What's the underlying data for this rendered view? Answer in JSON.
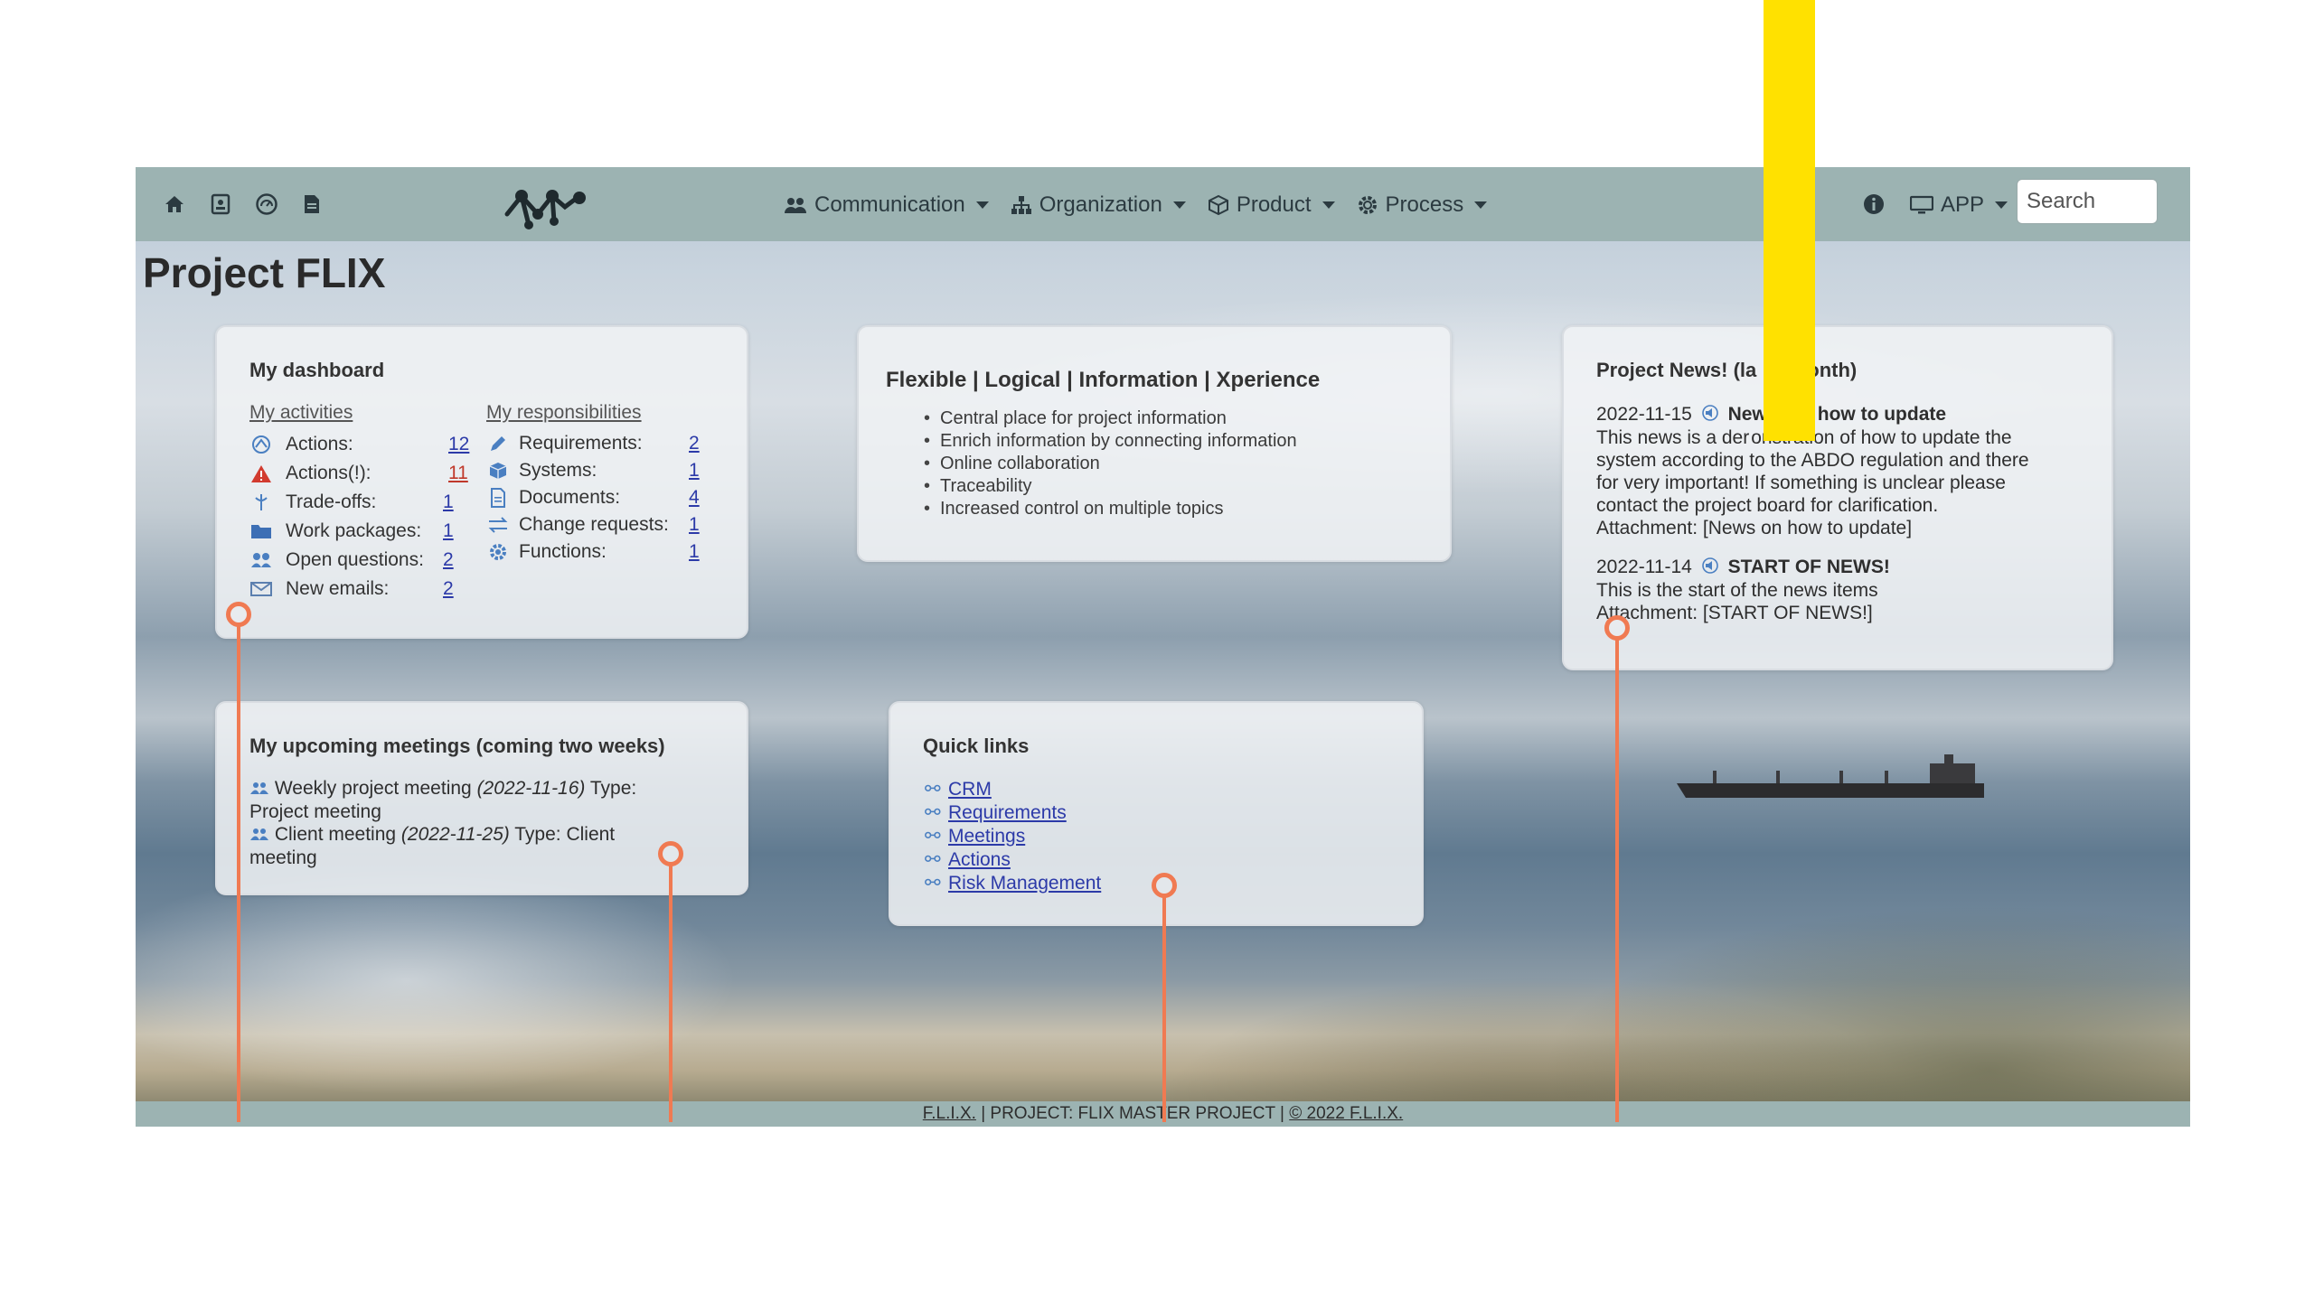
{
  "topbar": {
    "icons": [
      "home-icon",
      "contact-icon",
      "dashboard-icon",
      "document-icon"
    ],
    "logo": "flix-logo",
    "nav": [
      {
        "label": "Communication",
        "icon": "people-icon"
      },
      {
        "label": "Organization",
        "icon": "org-chart-icon"
      },
      {
        "label": "Product",
        "icon": "box-icon"
      },
      {
        "label": "Process",
        "icon": "gear-icon"
      }
    ],
    "info_icon": "info-icon",
    "app_label": "APP",
    "search_placeholder": "Search"
  },
  "page_title": "Project FLIX",
  "dashboard": {
    "title": "My dashboard",
    "activities_heading": "My activities",
    "responsibilities_heading": "My responsibilities",
    "activities": [
      {
        "label": "Actions:",
        "count": "12",
        "icon": "actions-icon"
      },
      {
        "label": "Actions(!):",
        "count": "11",
        "icon": "warning-icon"
      },
      {
        "label": "Trade-offs:",
        "count": "1",
        "icon": "tradeoff-icon"
      },
      {
        "label": "Work packages:",
        "count": "1",
        "icon": "folder-icon"
      },
      {
        "label": "Open questions:",
        "count": "2",
        "icon": "questions-icon"
      },
      {
        "label": "New emails:",
        "count": "2",
        "icon": "email-icon"
      }
    ],
    "responsibilities": [
      {
        "label": "Requirements:",
        "count": "2",
        "icon": "pencil-icon"
      },
      {
        "label": "Systems:",
        "count": "1",
        "icon": "cube-icon"
      },
      {
        "label": "Documents:",
        "count": "4",
        "icon": "document-icon"
      },
      {
        "label": "Change requests:",
        "count": "1",
        "icon": "swap-icon"
      },
      {
        "label": "Functions:",
        "count": "1",
        "icon": "cog-icon"
      }
    ]
  },
  "flix_card": {
    "title": "Flexible | Logical | Information | Xperience",
    "bullets": [
      "Central place for project information",
      "Enrich information by connecting information",
      "Online collaboration",
      "Traceability",
      "Increased control on multiple topics"
    ]
  },
  "news": {
    "title_left": "Project News! (la",
    "title_right": "onth)",
    "items": [
      {
        "date": "2022-11-15",
        "title_left": "New",
        "title_right": "how to update",
        "lines": [
          "This news is a der",
          "onstration of how to update the",
          "system according to the ABDO regulation and there",
          "for very important! If something is unclear please",
          "contact the project board for clarification."
        ],
        "attachment_prefix": "Attachment:",
        "attachment": "[News on how to update]"
      },
      {
        "date": "2022-11-14",
        "title": "START OF NEWS!",
        "lines": [
          "This is the start of the news items"
        ],
        "attachment_prefix": "Attachment:",
        "attachment": "[START OF NEWS!]"
      }
    ]
  },
  "meetings": {
    "title": "My upcoming meetings (coming two weeks)",
    "items": [
      {
        "name": "Weekly project meeting",
        "date": "(2022-11-16)",
        "type_prefix": "Type:",
        "type_line1": "",
        "type_line2": "Project meeting"
      },
      {
        "name": "Client meeting",
        "date": "(2022-11-25)",
        "type_prefix": "Type: Client",
        "type_line2": "meeting"
      }
    ]
  },
  "quick_links": {
    "title": "Quick links",
    "links": [
      "CRM",
      "Requirements",
      "Meetings",
      "Actions",
      "Risk Management"
    ]
  },
  "footer": {
    "org": "F.L.I.X.",
    "project": "| PROJECT: FLIX MASTER PROJECT |",
    "copyright": "© 2022 F.L.I.X."
  },
  "colors": {
    "topbar": "#9cb3b2",
    "link": "#2c3aa8",
    "alert": "#c0392b",
    "marker": "#f07a52",
    "highlight_bar": "#ffe100"
  }
}
